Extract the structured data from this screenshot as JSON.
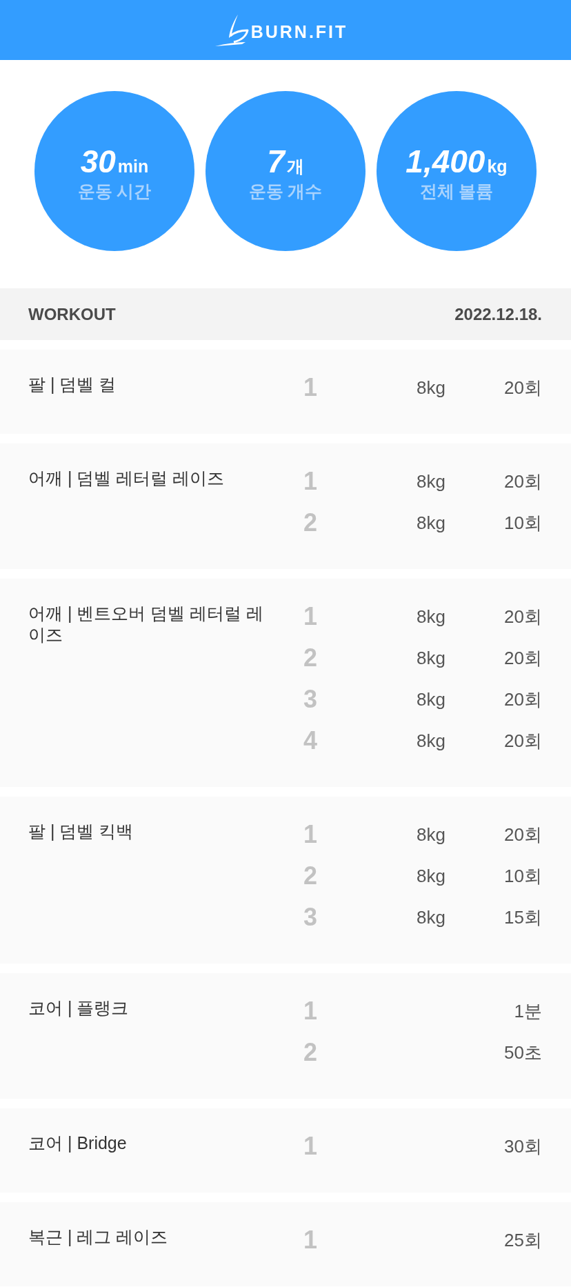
{
  "header": {
    "logo_text": "BURN.FIT"
  },
  "summary": [
    {
      "value": "30",
      "unit": "min",
      "label": "운동 시간"
    },
    {
      "value": "7",
      "unit": "개",
      "label": "운동 개수"
    },
    {
      "value": "1,400",
      "unit": "kg",
      "label": "전체 볼륨"
    }
  ],
  "workout_header": {
    "title": "WORKOUT",
    "date": "2022.12.18."
  },
  "exercises": [
    {
      "name": "팔 | 덤벨 컬",
      "sets": [
        {
          "number": "1",
          "weight": "8kg",
          "reps": "20회"
        }
      ]
    },
    {
      "name": "어깨 | 덤벨 레터럴 레이즈",
      "sets": [
        {
          "number": "1",
          "weight": "8kg",
          "reps": "20회"
        },
        {
          "number": "2",
          "weight": "8kg",
          "reps": "10회"
        }
      ]
    },
    {
      "name": "어깨 | 벤트오버 덤벨 레터럴 레이즈",
      "sets": [
        {
          "number": "1",
          "weight": "8kg",
          "reps": "20회"
        },
        {
          "number": "2",
          "weight": "8kg",
          "reps": "20회"
        },
        {
          "number": "3",
          "weight": "8kg",
          "reps": "20회"
        },
        {
          "number": "4",
          "weight": "8kg",
          "reps": "20회"
        }
      ]
    },
    {
      "name": "팔 | 덤벨 킥백",
      "sets": [
        {
          "number": "1",
          "weight": "8kg",
          "reps": "20회"
        },
        {
          "number": "2",
          "weight": "8kg",
          "reps": "10회"
        },
        {
          "number": "3",
          "weight": "8kg",
          "reps": "15회"
        }
      ]
    },
    {
      "name": "코어 | 플랭크",
      "sets": [
        {
          "number": "1",
          "reps": "1분"
        },
        {
          "number": "2",
          "reps": "50초"
        }
      ]
    },
    {
      "name": "코어 | Bridge",
      "sets": [
        {
          "number": "1",
          "reps": "30회"
        }
      ]
    },
    {
      "name": "복근 | 레그 레이즈",
      "sets": [
        {
          "number": "1",
          "reps": "25회"
        }
      ]
    }
  ]
}
